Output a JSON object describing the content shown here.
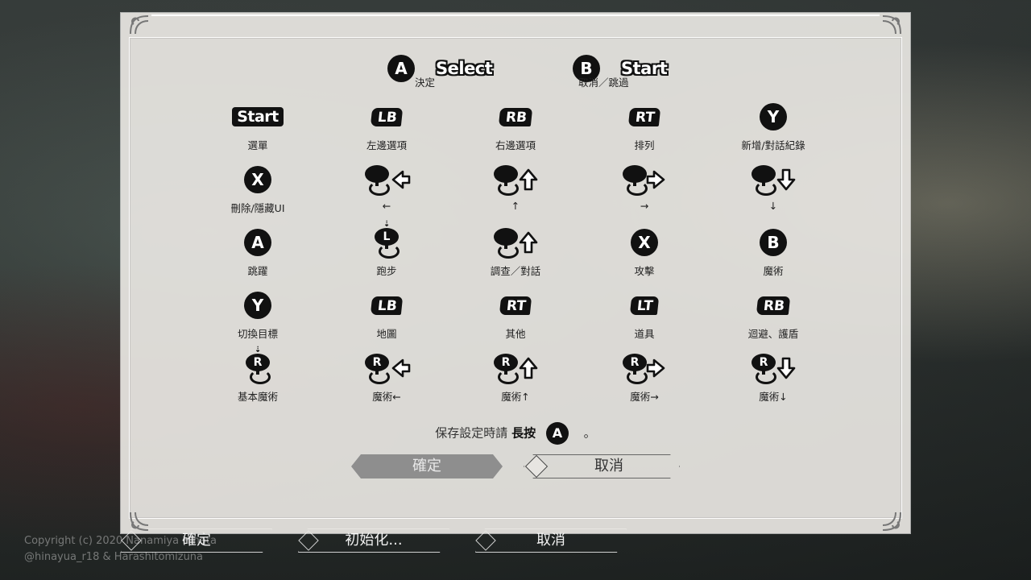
{
  "copyright": {
    "line1": "Copyright (c) 2020 Nanamiya Hinata",
    "line2": "@hinayua_r18 & Harashitomizuna"
  },
  "bottom_bar": {
    "confirm": "確定",
    "reset": "初始化...",
    "cancel": "取消"
  },
  "top_buttons": {
    "a": {
      "glyph": "A",
      "word": "Select",
      "label": "決定"
    },
    "b": {
      "glyph": "B",
      "word": "Start",
      "label": "取消／跳過"
    }
  },
  "grid": [
    {
      "icon": "start",
      "text": "Start",
      "label": "選單"
    },
    {
      "icon": "bumper-left",
      "text": "LB",
      "label": "左邊選項"
    },
    {
      "icon": "bumper-right",
      "text": "RB",
      "label": "右邊選項"
    },
    {
      "icon": "trigger-right",
      "text": "RT",
      "label": "排列"
    },
    {
      "icon": "circle",
      "text": "Y",
      "label": "新增/對話紀錄"
    },
    {
      "icon": "circle",
      "text": "X",
      "label": "刪除/隱藏UI"
    },
    {
      "icon": "stick-left-arrow",
      "text": "",
      "label": "←"
    },
    {
      "icon": "stick-up-arrow",
      "text": "",
      "label": "↑"
    },
    {
      "icon": "stick-right-arrow",
      "text": "",
      "label": "→"
    },
    {
      "icon": "stick-down-arrow",
      "text": "",
      "label": "↓"
    },
    {
      "icon": "circle",
      "text": "A",
      "label": "跳躍"
    },
    {
      "icon": "stick-press-l",
      "text": "L",
      "label": "跑步"
    },
    {
      "icon": "stick-up-arrow",
      "text": "",
      "label": "調查／對話"
    },
    {
      "icon": "circle",
      "text": "X",
      "label": "攻擊"
    },
    {
      "icon": "circle",
      "text": "B",
      "label": "魔術"
    },
    {
      "icon": "circle",
      "text": "Y",
      "label": "切換目標"
    },
    {
      "icon": "bumper-left",
      "text": "LB",
      "label": "地圖"
    },
    {
      "icon": "trigger-right",
      "text": "RT",
      "label": "其他"
    },
    {
      "icon": "trigger-left",
      "text": "LT",
      "label": "道具"
    },
    {
      "icon": "bumper-right",
      "text": "RB",
      "label": "迴避、護盾"
    },
    {
      "icon": "stick-press-r",
      "text": "R",
      "label": "基本魔術"
    },
    {
      "icon": "stick-r-left",
      "text": "R",
      "label": "魔術←"
    },
    {
      "icon": "stick-r-up",
      "text": "R",
      "label": "魔術↑"
    },
    {
      "icon": "stick-r-right",
      "text": "R",
      "label": "魔術→"
    },
    {
      "icon": "stick-r-down",
      "text": "R",
      "label": "魔術↓"
    }
  ],
  "hold_note": {
    "prefix": "保存設定時請",
    "bold": "長按",
    "glyph": "A",
    "suffix": "。"
  },
  "dialog_buttons": {
    "confirm": "確定",
    "cancel": "取消"
  }
}
